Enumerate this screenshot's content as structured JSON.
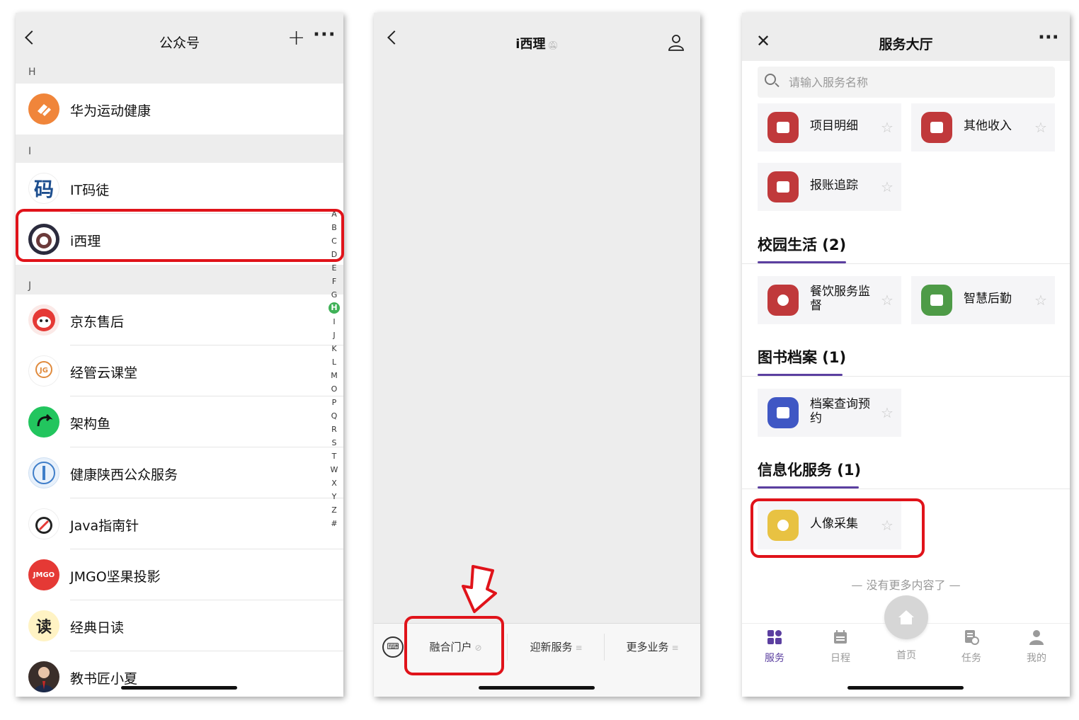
{
  "screen1": {
    "title": "公众号",
    "sections": [
      {
        "letter": "H",
        "items": [
          {
            "name": "华为运动健康"
          }
        ]
      },
      {
        "letter": "I",
        "items": [
          {
            "name": "IT码徒"
          },
          {
            "name": "i西理"
          }
        ]
      },
      {
        "letter": "J",
        "items": [
          {
            "name": "京东售后"
          },
          {
            "name": "经管云课堂"
          },
          {
            "name": "架构鱼"
          },
          {
            "name": "健康陕西公众服务"
          },
          {
            "name": "Java指南针"
          },
          {
            "name": "JMGO坚果投影"
          },
          {
            "name": "经典日读"
          },
          {
            "name": "教书匠小夏"
          }
        ]
      }
    ],
    "avatar_text": {
      "itmatu": "码",
      "jmgo": "JMGO",
      "dudu": "读"
    },
    "index": [
      "A",
      "B",
      "C",
      "D",
      "E",
      "F",
      "G",
      "H",
      "I",
      "J",
      "K",
      "L",
      "M",
      "O",
      "P",
      "Q",
      "R",
      "S",
      "T",
      "W",
      "X",
      "Y",
      "Z",
      "#"
    ],
    "index_selected": "H"
  },
  "screen2": {
    "title": "i西理",
    "menus": [
      {
        "label": "融合门户",
        "suffix": "⊘"
      },
      {
        "label": "迎新服务",
        "suffix": "≡"
      },
      {
        "label": "更多业务",
        "suffix": "≡"
      }
    ]
  },
  "screen3": {
    "title": "服务大厅",
    "search_placeholder": "请输入服务名称",
    "top_cards": [
      {
        "label": "项目明细"
      },
      {
        "label": "其他收入"
      },
      {
        "label": "报账追踪"
      }
    ],
    "categories": [
      {
        "title": "校园生活 (2)",
        "cards": [
          {
            "label": "餐饮服务监督"
          },
          {
            "label": "智慧后勤"
          }
        ]
      },
      {
        "title": "图书档案 (1)",
        "cards": [
          {
            "label": "档案查询预约"
          }
        ]
      },
      {
        "title": "信息化服务 (1)",
        "cards": [
          {
            "label": "人像采集"
          }
        ]
      }
    ],
    "no_more": "— 没有更多内容了 —",
    "tabs": [
      {
        "label": "服务",
        "active": true
      },
      {
        "label": "日程"
      },
      {
        "label": "首页"
      },
      {
        "label": "任务"
      },
      {
        "label": "我的"
      }
    ],
    "colors": {
      "accent": "#5b3fa0",
      "red": "#c0393b",
      "green": "#4e9b47",
      "blue": "#3f57c4",
      "yellow": "#e8c242"
    }
  }
}
